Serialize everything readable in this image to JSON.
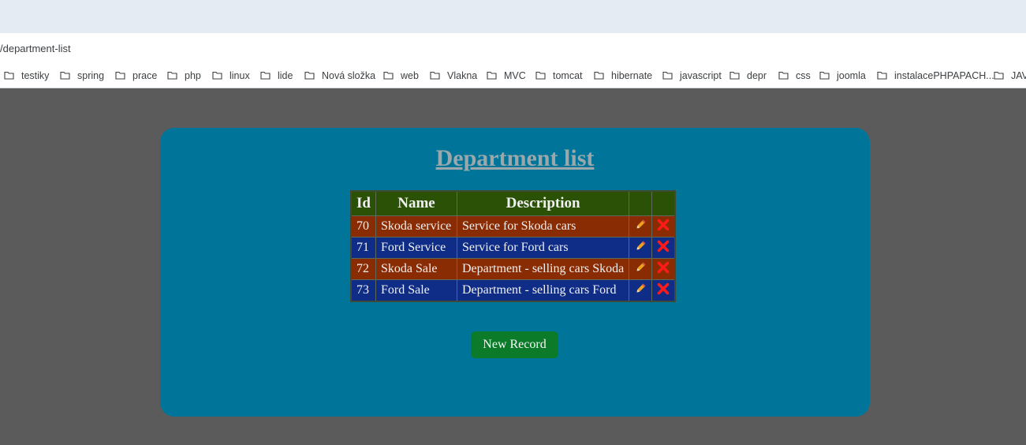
{
  "browser": {
    "url": "/department-list",
    "bookmarks": [
      {
        "label": "testiky"
      },
      {
        "label": "spring"
      },
      {
        "label": "prace"
      },
      {
        "label": "php"
      },
      {
        "label": "linux"
      },
      {
        "label": "lide"
      },
      {
        "label": "Nová složka"
      },
      {
        "label": "web"
      },
      {
        "label": "Vlakna"
      },
      {
        "label": "MVC"
      },
      {
        "label": "tomcat"
      },
      {
        "label": "hibernate"
      },
      {
        "label": "javascript"
      },
      {
        "label": "depr"
      },
      {
        "label": "css"
      },
      {
        "label": "joomla"
      },
      {
        "label": "instalacePHPAPACH..."
      },
      {
        "label": "JAV"
      }
    ]
  },
  "page": {
    "title": "Department list",
    "table": {
      "headers": [
        "Id",
        "Name",
        "Description",
        "",
        ""
      ],
      "rows": [
        {
          "id": "70",
          "name": "Skoda service",
          "description": "Service for Skoda cars"
        },
        {
          "id": "71",
          "name": "Ford Service",
          "description": "Service for Ford cars"
        },
        {
          "id": "72",
          "name": "Skoda Sale",
          "description": "Department - selling cars Skoda"
        },
        {
          "id": "73",
          "name": "Ford Sale",
          "description": "Department - selling cars Ford"
        }
      ],
      "row_actions": [
        "pencil-icon",
        "delete-x-icon"
      ]
    },
    "new_record_label": "New Record"
  },
  "colors": {
    "background": "#5b5b5b",
    "panel": "#007599",
    "header_row": "#2a5106",
    "odd_row": "#8a2c03",
    "even_row": "#0f2d86",
    "button": "#0b7b2a",
    "delete_icon": "#ff1a1a",
    "edit_icon": "#f0a020"
  }
}
